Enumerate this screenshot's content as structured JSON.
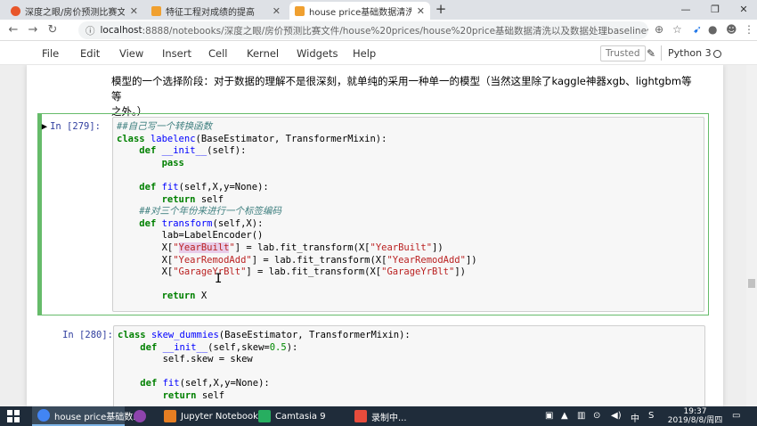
{
  "browser": {
    "tabs": [
      {
        "title": "深度之眼/房价预测比赛文件/ho",
        "color": "#e8562a"
      },
      {
        "title": "特征工程对成绩的提高",
        "color": "#f0a030"
      },
      {
        "title": "house price基础数据清洗以及抽",
        "color": "#f0a030"
      }
    ],
    "new_tab": "+",
    "window_controls": {
      "minimize": "—",
      "maximize": "❐",
      "close": "✕"
    },
    "url_host": "localhost",
    "url_path": ":8888/notebooks/深度之眼/房价预测比赛文件/house%20prices/house%20price基础数据清洗以及数据处理baseline代码文件.ipynb"
  },
  "jupyter": {
    "menu": [
      "File",
      "Edit",
      "View",
      "Insert",
      "Cell",
      "Kernel",
      "Widgets",
      "Help"
    ],
    "trusted": "Trusted",
    "kernel": "Python 3"
  },
  "notebook": {
    "markdown_line1": "模型的一个选择阶段：对于数据的理解不是很深刻，就单纯的采用一种单一的模型（当然这里除了kaggle神器xgb、lightgbm等等",
    "markdown_line2": "之外。）",
    "cell1_prompt": "In  [279]:",
    "cell2_prompt": "In  [280]:"
  },
  "taskbar": {
    "items": [
      {
        "label": "house price基础数...",
        "color": "#4285f4"
      },
      {
        "label": "",
        "color": "#8e44ad"
      },
      {
        "label": "Jupyter Notebook",
        "color": "#e67e22"
      },
      {
        "label": "Camtasia 9",
        "color": "#27ae60"
      },
      {
        "label": "录制中...",
        "color": "#e74c3c"
      }
    ],
    "ime": "中",
    "time": "19:37",
    "date": "2019/8/8/周四"
  }
}
